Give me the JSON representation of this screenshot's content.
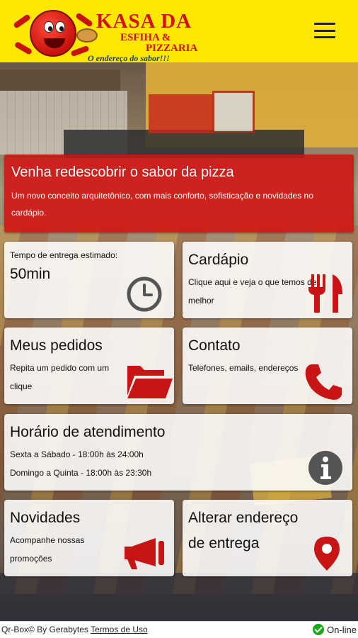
{
  "header": {
    "logo": {
      "title": "KASA DA",
      "line2": "ESFIHA &",
      "line3": "PIZZARIA",
      "slogan": "O endereço do sabor!!!"
    },
    "menu_icon": "hamburger-menu-icon"
  },
  "banner": {
    "title": "Venha redescobrir o sabor da pizza",
    "text": "Um novo conceito arquitetônico, com mais conforto, sofisticação e novidades no cardápio."
  },
  "cards": {
    "delivery_time": {
      "label": "Tempo de entrega estimado:",
      "value": "50min",
      "icon": "clock-icon"
    },
    "menu": {
      "title": "Cardápio",
      "desc": "Clique aqui e veja o que temos de melhor",
      "icon": "fork-knife-icon"
    },
    "orders": {
      "title": "Meus pedidos",
      "desc": "Repita um pedido com um clique",
      "icon": "folder-icon"
    },
    "contact": {
      "title": "Contato",
      "desc": "Telefones, emails, endereços",
      "icon": "phone-icon"
    },
    "hours": {
      "title": "Horário de atendimento",
      "line1": "Sexta a Sábado - 18:00h às 24:00h",
      "line2": "Domingo a Quinta - 18:00h às 23:30h",
      "icon": "info-icon"
    },
    "news": {
      "title": "Novidades",
      "desc": "Acompanhe nossas promoções",
      "icon": "megaphone-icon"
    },
    "address": {
      "title_line1": "Alterar endereço",
      "title_line2": "de entrega",
      "icon": "map-pin-icon"
    }
  },
  "footer": {
    "credit": "Qr-Box© By Gerabytes",
    "terms": "Termos de Uso",
    "status": "On-line",
    "status_icon": "check-circle-icon"
  },
  "colors": {
    "header_bg": "#ffe800",
    "brand_red": "#d40f0f",
    "icon_gray": "#555555",
    "online_green": "#18a818"
  }
}
